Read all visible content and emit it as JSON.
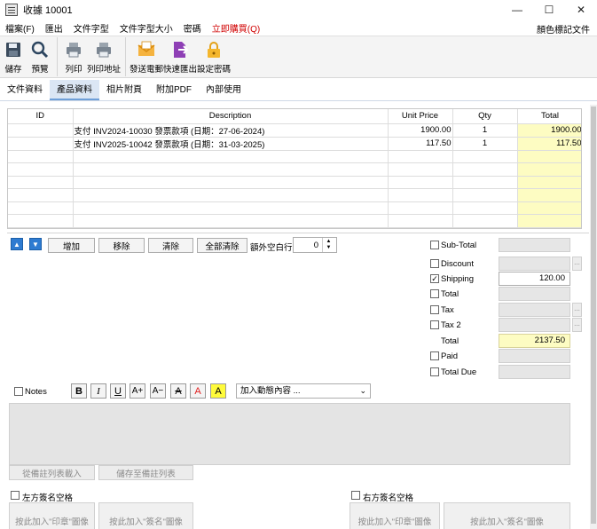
{
  "window": {
    "title": "收據 10001",
    "minimize": "—",
    "maximize": "☐",
    "close": "✕"
  },
  "menu": {
    "items": [
      "檔案(F)",
      "匯出",
      "文件字型",
      "文件字型大小",
      "密碼"
    ],
    "buy": "立即購買(Q)",
    "right": "顏色標記文件"
  },
  "toolbar": {
    "save": "儲存",
    "preview": "預覽",
    "print": "列印",
    "print_address": "列印地址",
    "send_email": "發送電郵",
    "quick_export": "快速匯出",
    "set_password": "設定密碼"
  },
  "tabs": [
    "文件資料",
    "產品資料",
    "相片附頁",
    "附加PDF",
    "內部使用"
  ],
  "grid": {
    "headers": [
      "ID",
      "Description",
      "Unit Price",
      "Qty",
      "Total"
    ],
    "rows": [
      [
        "",
        "支付 INV2024-10030 發票款項 (日期：27-06-2024)",
        "1900.00",
        "1",
        "1900.00"
      ],
      [
        "",
        "支付 INV2025-10042 發票款項 (日期：31-03-2025)",
        "117.50",
        "1",
        "117.50"
      ]
    ]
  },
  "item_buttons": {
    "add": "增加",
    "remove": "移除",
    "clear": "清除",
    "clear_all": "全部清除",
    "extra_rows_label": "額外空白行",
    "extra_rows": "0"
  },
  "summary": {
    "subtotal": "Sub-Total",
    "discount": "Discount",
    "shipping": "Shipping",
    "shipping_value": "120.00",
    "total1": "Total",
    "tax": "Tax",
    "tax2": "Tax 2",
    "total_label": "Total",
    "total_value": "2137.50",
    "paid": "Paid",
    "total_due": "Total Due",
    "check": "✓",
    "ellipsis": "..."
  },
  "notes": {
    "label": "Notes",
    "dropdown": "加入動態內容 ...",
    "load_btn": "從備註列表載入",
    "save_btn": "儲存至備註列表"
  },
  "format": {
    "bold": "B",
    "italic": "I",
    "underline": "U",
    "grow": "A+",
    "shrink": "A−",
    "strike": "A",
    "color": "A",
    "highlight": "A"
  },
  "signature": {
    "left_label": "左方簽名空格",
    "right_label": "右方簽名空格",
    "stamp_box": "按此加入\"印章\"圖像",
    "sign_box": "按此加入\"簽名\"圖像"
  }
}
